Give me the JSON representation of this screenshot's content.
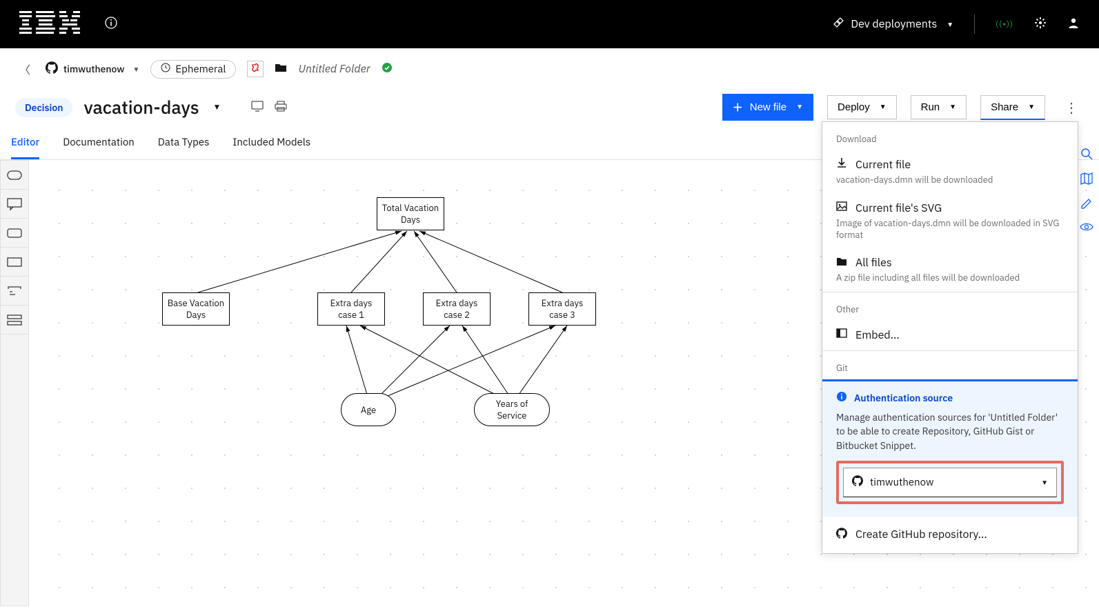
{
  "topbar": {
    "logo_aria": "IBM",
    "dev_deployments": "Dev deployments"
  },
  "breadcrumb": {
    "github_user": "timwuthenow",
    "ephemeral_label": "Ephemeral",
    "folder_name": "Untitled Folder"
  },
  "file": {
    "decision_badge": "Decision",
    "title": "vacation-days"
  },
  "actions": {
    "new_file": "New file",
    "deploy": "Deploy",
    "run": "Run",
    "share": "Share"
  },
  "tabs": [
    "Editor",
    "Documentation",
    "Data Types",
    "Included Models"
  ],
  "diagram": {
    "nodes": {
      "total_vacation": "Total Vacation Days",
      "base_vacation": "Base Vacation Days",
      "extra1": "Extra days case 1",
      "extra2": "Extra days case 2",
      "extra3": "Extra days case 3",
      "age": "Age",
      "years": "Years of Service"
    }
  },
  "share_panel": {
    "download_label": "Download",
    "current_file_title": "Current file",
    "current_file_sub": "vacation-days.dmn will be downloaded",
    "svg_title": "Current file's SVG",
    "svg_sub": "Image of vacation-days.dmn will be downloaded in SVG format",
    "all_files_title": "All files",
    "all_files_sub": "A zip file including all files will be downloaded",
    "other_label": "Other",
    "embed_title": "Embed...",
    "git_label": "Git",
    "auth_title": "Authentication source",
    "auth_desc": "Manage authentication sources for 'Untitled Folder' to be able to create Repository, GitHub Gist or Bitbucket Snippet.",
    "auth_selected": "timwuthenow",
    "create_repo": "Create GitHub repository..."
  }
}
